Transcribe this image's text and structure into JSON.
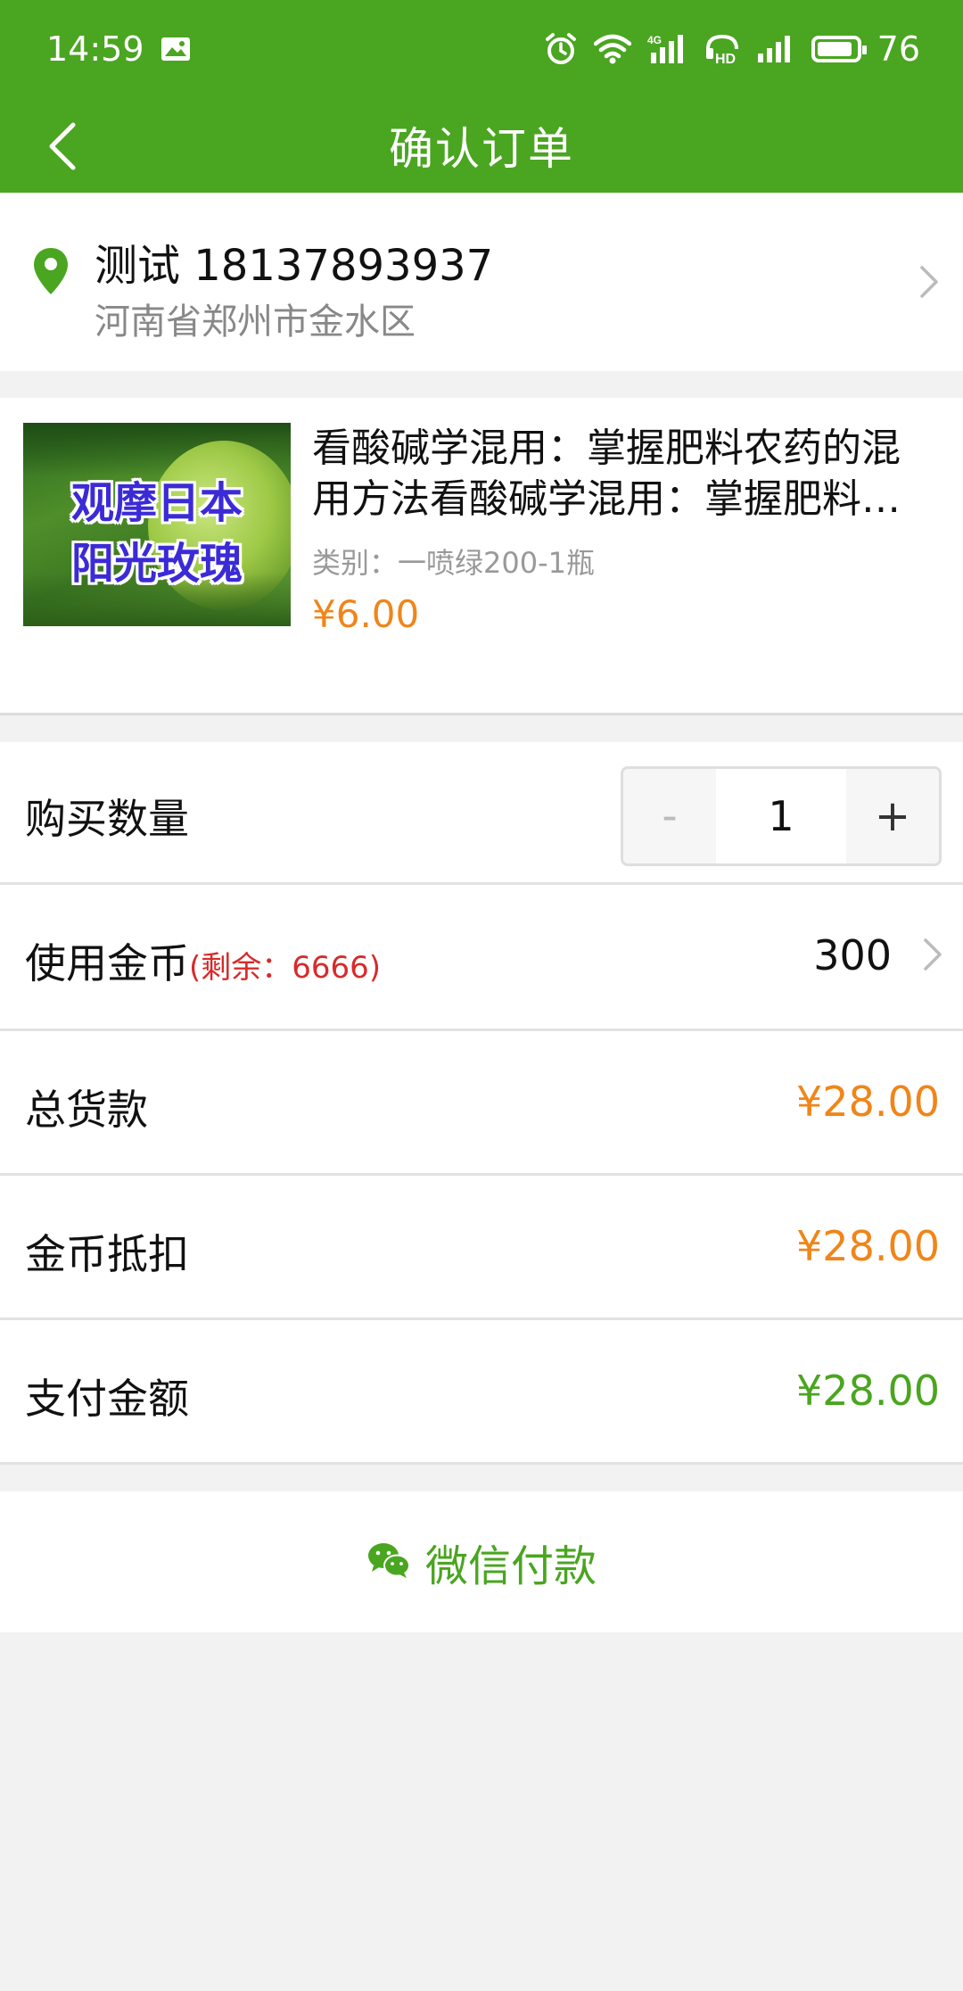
{
  "status_bar": {
    "time": "14:59",
    "network": "4G",
    "hd": "HD",
    "battery": "76"
  },
  "nav": {
    "title": "确认订单"
  },
  "address": {
    "name_phone": "测试 18137893937",
    "detail": "河南省郑州市金水区"
  },
  "product": {
    "image_text_line1": "观摩日本",
    "image_text_line2": "阳光玫瑰",
    "title": "看酸碱学混用：掌握肥料农药的混用方法看酸碱学混用：掌握肥料农药的混用方法",
    "spec": "类别：一喷绿200-1瓶",
    "price": "¥6.00"
  },
  "quantity": {
    "label": "购买数量",
    "minus": "-",
    "value": "1",
    "plus": "+"
  },
  "coins": {
    "label": "使用金币",
    "remaining": "(剩余：6666)",
    "value": "300"
  },
  "total": {
    "label": "总货款",
    "value": "¥28.00"
  },
  "discount": {
    "label": "金币抵扣",
    "value": "¥28.00"
  },
  "payable": {
    "label": "支付金额",
    "value": "¥28.00"
  },
  "pay_button": {
    "label": "微信付款"
  },
  "colors": {
    "brand_green": "#4aa520",
    "price_orange": "#f08519",
    "alert_red": "#d62b2b"
  }
}
